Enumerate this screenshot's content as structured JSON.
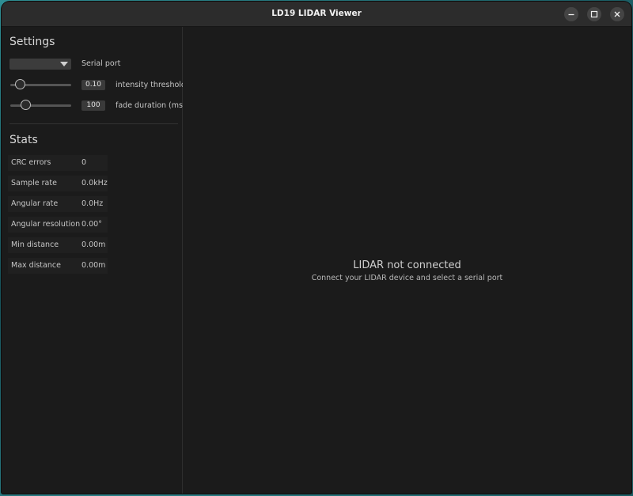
{
  "window": {
    "title": "LD19 LIDAR Viewer",
    "controls": [
      "minimize-icon",
      "maximize-icon",
      "close-icon"
    ]
  },
  "settings": {
    "heading": "Settings",
    "serial_port": {
      "label": "Serial port",
      "selected": ""
    },
    "intensity": {
      "value": "0.10",
      "label": "intensity threshold",
      "level": 0.1
    },
    "fade": {
      "value": "100",
      "label": "fade duration (ms)",
      "level": 0.2
    }
  },
  "stats": {
    "heading": "Stats",
    "rows": [
      {
        "label": "CRC errors",
        "value": "0"
      },
      {
        "label": "Sample rate",
        "value": "0.0kHz"
      },
      {
        "label": "Angular rate",
        "value": "0.0Hz"
      },
      {
        "label": "Angular resolution",
        "value": "0.00°"
      },
      {
        "label": "Min distance",
        "value": "0.00m"
      },
      {
        "label": "Max distance",
        "value": "0.00m"
      }
    ]
  },
  "main": {
    "status_title": "LIDAR not connected",
    "status_subtitle": "Connect your LIDAR device and select a serial port"
  },
  "colors": {
    "window_bg": "#1b1b1b",
    "titlebar_bg": "#2c2c2c",
    "text": "#c6c6c6"
  }
}
